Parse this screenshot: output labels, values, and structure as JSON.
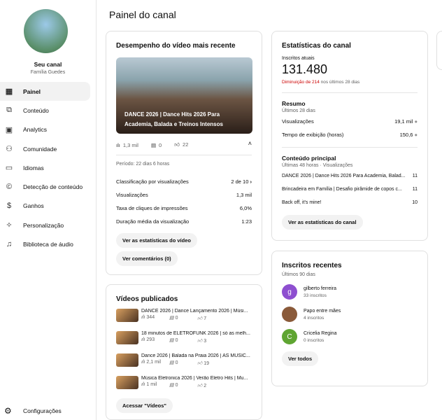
{
  "sidebar": {
    "channel_label": "Seu canal",
    "channel_name": "Família Guedes",
    "items": [
      {
        "label": "Painel",
        "icon": "dashboard-icon"
      },
      {
        "label": "Conteúdo",
        "icon": "content-icon"
      },
      {
        "label": "Analytics",
        "icon": "analytics-icon"
      },
      {
        "label": "Comunidade",
        "icon": "community-icon"
      },
      {
        "label": "Idiomas",
        "icon": "subtitles-icon"
      },
      {
        "label": "Detecção de conteúdo",
        "icon": "copyright-icon"
      },
      {
        "label": "Ganhos",
        "icon": "dollar-icon"
      },
      {
        "label": "Personalização",
        "icon": "magic-wand-icon"
      },
      {
        "label": "Biblioteca de áudio",
        "icon": "audio-library-icon"
      }
    ],
    "settings": "Configurações"
  },
  "page_title": "Painel do canal",
  "latest": {
    "title": "Desempenho do vídeo mais recente",
    "video_title": "DANCE 2026 | Dance Hits 2026 Para Academia, Balada e Treinos Intensos",
    "views": "1,3 mil",
    "comments": "0",
    "likes": "22",
    "period": "Período: 22 dias 6 horas",
    "rows": [
      {
        "label": "Classificação por visualizações",
        "value": "2 de 10"
      },
      {
        "label": "Visualizações",
        "value": "1,3 mil"
      },
      {
        "label": "Taxa de cliques de impressões",
        "value": "6,0%"
      },
      {
        "label": "Duração média da visualização",
        "value": "1:23"
      }
    ],
    "btn_stats": "Ver as estatísticas do vídeo",
    "btn_comments": "Ver comentários (0)"
  },
  "channel": {
    "title": "Estatísticas do canal",
    "subs_label": "Inscritos atuais",
    "subs": "131.480",
    "change_red": "Diminuição de 214",
    "change_rest": " nos últimos 28 dias",
    "summary_title": "Resumo",
    "summary_sub": "Últimos 28 dias",
    "summary": [
      {
        "label": "Visualizações",
        "value": "19,1 mil"
      },
      {
        "label": "Tempo de exibição (horas)",
        "value": "150,6"
      }
    ],
    "top_title": "Conteúdo principal",
    "top_sub": "Últimas 48 horas · Visualizações",
    "top": [
      {
        "title": "DANCE 2026 | Dance Hits 2026 Para Academia, Balad...",
        "value": "11"
      },
      {
        "title": "Brincadeira em Família | Desafio pirâmide de copos c...",
        "value": "11"
      },
      {
        "title": "Back off, it's mine!",
        "value": "10"
      }
    ],
    "btn": "Ver as estatísticas do canal"
  },
  "published": {
    "title": "Vídeos publicados",
    "videos": [
      {
        "title": "DANCE 2026 | Dance Lançamento 2026 | Músi...",
        "views": "344",
        "comments": "0",
        "likes": "7"
      },
      {
        "title": "18 minutos de ELETROFUNK 2026 | só as melh...",
        "views": "293",
        "comments": "0",
        "likes": "3"
      },
      {
        "title": "Dance 2026 | Balada na Praia 2026 | AS MÚSIC...",
        "views": "2,1 mil",
        "comments": "0",
        "likes": "19"
      },
      {
        "title": "Música Eletronica 2026 | Verão Eletro Hits | Mu...",
        "views": "1 mil",
        "comments": "0",
        "likes": "2"
      }
    ],
    "btn": "Acessar \"Vídeos\""
  },
  "recent": {
    "title": "Inscritos recentes",
    "sub": "Últimos 90 dias",
    "subs": [
      {
        "initial": "g",
        "name": "gilberto ferreira",
        "count": "33 inscritos",
        "color": "#8e4fd0"
      },
      {
        "initial": "",
        "name": "Papo entre mães",
        "count": "4 inscritos",
        "color": "#8a5a3a"
      },
      {
        "initial": "C",
        "name": "Cricelia Regina",
        "count": "0 inscritos",
        "color": "#5fa532"
      }
    ],
    "btn": "Ver todos"
  }
}
